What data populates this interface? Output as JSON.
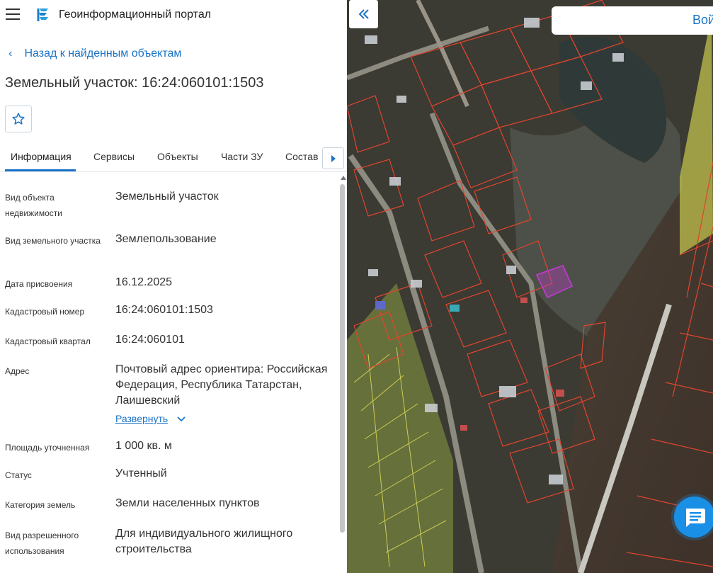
{
  "header": {
    "app_title": "Геоинформационный портал",
    "menu_icon": "menu-icon",
    "logo_icon": "portal-logo-icon"
  },
  "back_link": {
    "label": "Назад к найденным объектам"
  },
  "page_title": "Земельный участок: 16:24:060101:1503",
  "favorite_icon": "star-icon",
  "tabs": [
    {
      "label": "Информация",
      "active": true
    },
    {
      "label": "Сервисы"
    },
    {
      "label": "Объекты"
    },
    {
      "label": "Части ЗУ"
    },
    {
      "label": "Состав"
    }
  ],
  "fields": [
    {
      "label": "Вид объекта недвижимости",
      "value": "Земельный участок"
    },
    {
      "label": "Вид земельного участка",
      "value": "Землепользование"
    },
    {
      "label": "Дата присвоения",
      "value": "16.12.2025"
    },
    {
      "label": "Кадастровый номер",
      "value": "16:24:060101:1503"
    },
    {
      "label": "Кадастровый квартал",
      "value": "16:24:060101"
    },
    {
      "label": "Адрес",
      "value": "Почтовый адрес ориентира: Российская Федерация, Республика Татарстан, Лаишевский",
      "expand_label": "Развернуть"
    },
    {
      "label": "Площадь уточненная",
      "value": "1 000 кв. м"
    },
    {
      "label": "Статус",
      "value": "Учтенный"
    },
    {
      "label": "Категория земель",
      "value": "Земли населенных пунктов"
    },
    {
      "label": "Вид разрешенного использования",
      "value": "Для индивидуального жилищного строительства"
    }
  ],
  "map": {
    "login_label": "Войти",
    "collapse_icon": "double-chevron-left-icon",
    "chat_icon": "chat-icon",
    "colors": {
      "parcel_border": "#e0452e",
      "selected_parcel": "#c23bd4",
      "highlight_zone": "#d6d65a"
    }
  }
}
